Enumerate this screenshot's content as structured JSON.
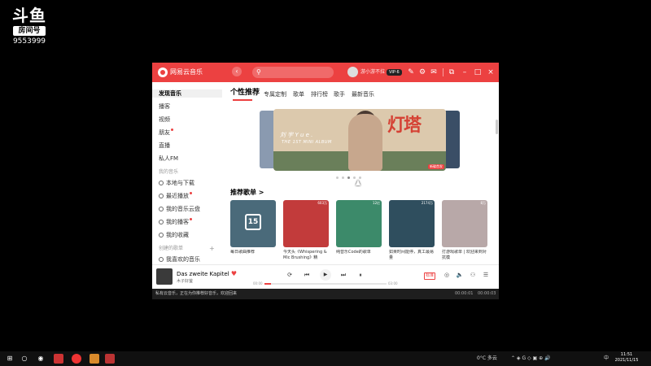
{
  "overlay": {
    "brand": "斗鱼",
    "room_label": "房间号",
    "room_number": "9553999"
  },
  "window": {
    "app_name": "网易云音乐",
    "username": "游小游不拉",
    "vip_badge": "VIP·6"
  },
  "sidebar": {
    "items": [
      {
        "label": "发现音乐",
        "active": true
      },
      {
        "label": "播客"
      },
      {
        "label": "视频"
      },
      {
        "label": "朋友",
        "dot": true
      },
      {
        "label": "直播"
      },
      {
        "label": "私人FM"
      }
    ],
    "my_music_title": "我的音乐",
    "my_music": [
      {
        "label": "本地与下载"
      },
      {
        "label": "最近播放",
        "dot": true
      },
      {
        "label": "我的音乐云盘"
      },
      {
        "label": "我的播客",
        "dot": true
      },
      {
        "label": "我的收藏"
      }
    ],
    "created_title": "创建的歌单",
    "created": [
      {
        "label": "我喜欢的音乐"
      }
    ]
  },
  "tabs": [
    "个性推荐",
    "专属定制",
    "歌单",
    "排行榜",
    "歌手",
    "最新音乐"
  ],
  "banner": {
    "artist": "刘 宇 Y u e .",
    "album": "THE 1ST MINI ALBUM",
    "big_text": "灯塔",
    "tag": "新碟首发"
  },
  "section": {
    "title": "推荐歌单 >"
  },
  "cards": [
    {
      "caption": "每日歌曲推荐",
      "plays": "",
      "calendar_day": "15",
      "color": "#4a6a7a"
    },
    {
      "caption": "今天头《Whispering & Mic Brushing》精",
      "plays": "603万",
      "color": "#c23b3b"
    },
    {
      "caption": "纯音乐Code的歌单",
      "plays": "12亿",
      "color": "#3c8a6a"
    },
    {
      "caption": "如果时间能停，真工最易量",
      "plays": "2174万",
      "color": "#2f4e5e"
    },
    {
      "caption": "打游戏歌单 | 欢迎来到对抗模",
      "plays": "8万",
      "color": "#b8a8a8"
    }
  ],
  "player": {
    "song": "Das zweite Kapitel",
    "artist": "木子好萤",
    "time_current": "00:00",
    "time_total": "03:00",
    "progress": 0.05,
    "quality": "标准"
  },
  "statusbar": {
    "text": "私有云音乐，正在为你推荐好音乐，欢迎回来",
    "time_left": "00:00:01",
    "time_right": "00:00:03"
  },
  "taskbar": {
    "weather": "0°C 多云",
    "time": "11:51",
    "date": "2021/11/15",
    "lang": "中"
  }
}
